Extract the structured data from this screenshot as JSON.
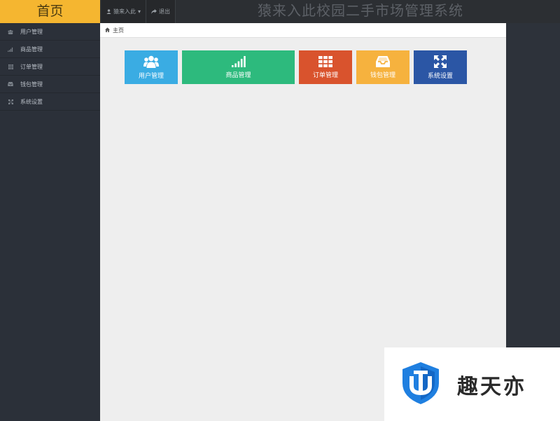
{
  "header": {
    "brand": "首页",
    "nav": [
      {
        "label": "猿来入此",
        "icon": "user-icon",
        "caret": "▾"
      },
      {
        "label": "退出",
        "icon": "share-icon"
      }
    ],
    "system_title": "猿来入此校园二手市场管理系统"
  },
  "sidebar": {
    "items": [
      {
        "label": "用户管理",
        "icon": "users-icon"
      },
      {
        "label": "商品管理",
        "icon": "signal-icon"
      },
      {
        "label": "订单管理",
        "icon": "grid-icon"
      },
      {
        "label": "钱包管理",
        "icon": "inbox-icon"
      },
      {
        "label": "系统设置",
        "icon": "expand-icon"
      }
    ]
  },
  "breadcrumb": {
    "icon": "home-icon",
    "label": "主页"
  },
  "tiles": [
    {
      "label": "用户管理",
      "icon": "users-icon",
      "color": "#3aace3"
    },
    {
      "label": "商品管理",
      "icon": "signal-icon",
      "color": "#2dba7d"
    },
    {
      "label": "订单管理",
      "icon": "grid-icon",
      "color": "#d9532d"
    },
    {
      "label": "钱包管理",
      "icon": "inbox-icon",
      "color": "#f6b23e"
    },
    {
      "label": "系统设置",
      "icon": "expand-icon",
      "color": "#2b56a5"
    }
  ],
  "watermark": {
    "text": "趣天亦",
    "icon": "shield-logo-icon"
  },
  "colors": {
    "brand": "#f5b630",
    "sidebar": "#2b3039",
    "content_bg": "#eeeeee"
  }
}
